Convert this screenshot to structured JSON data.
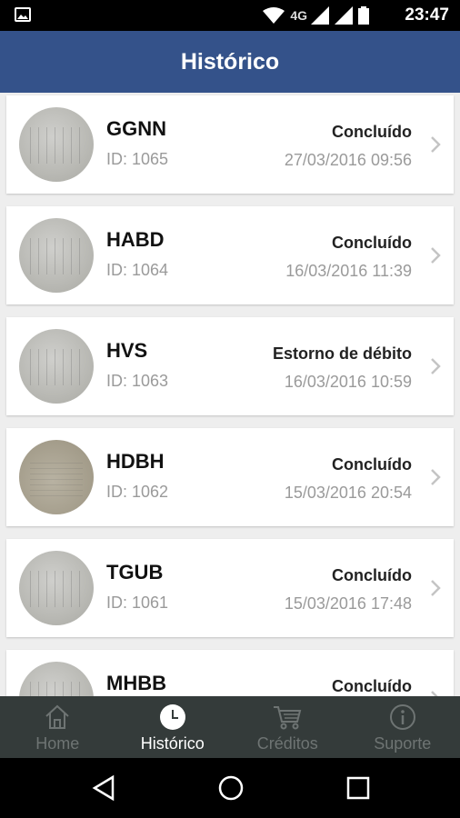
{
  "status_bar": {
    "network": "4G",
    "time": "23:47"
  },
  "header": {
    "title": "Histórico"
  },
  "transactions": [
    {
      "code": "GGNN",
      "id": "ID: 1065",
      "status": "Concluído",
      "date": "27/03/2016 09:56"
    },
    {
      "code": "HABD",
      "id": "ID: 1064",
      "status": "Concluído",
      "date": "16/03/2016 11:39"
    },
    {
      "code": "HVS",
      "id": "ID: 1063",
      "status": "Estorno de débito",
      "date": "16/03/2016 10:59"
    },
    {
      "code": "HDBH",
      "id": "ID: 1062",
      "status": "Concluído",
      "date": "15/03/2016 20:54"
    },
    {
      "code": "TGUB",
      "id": "ID: 1061",
      "status": "Concluído",
      "date": "15/03/2016 17:48"
    },
    {
      "code": "MHBB",
      "id": "",
      "status": "Concluído",
      "date": ""
    }
  ],
  "bottom_nav": [
    {
      "label": "Home",
      "icon": "home-icon",
      "active": false
    },
    {
      "label": "Histórico",
      "icon": "clock-icon",
      "active": true
    },
    {
      "label": "Créditos",
      "icon": "cart-icon",
      "active": false
    },
    {
      "label": "Suporte",
      "icon": "info-icon",
      "active": false
    }
  ],
  "colors": {
    "app_bar": "#34528a",
    "bottom_nav": "#343b3a",
    "active_label": "#ffffff",
    "inactive_label": "#6e7473"
  }
}
